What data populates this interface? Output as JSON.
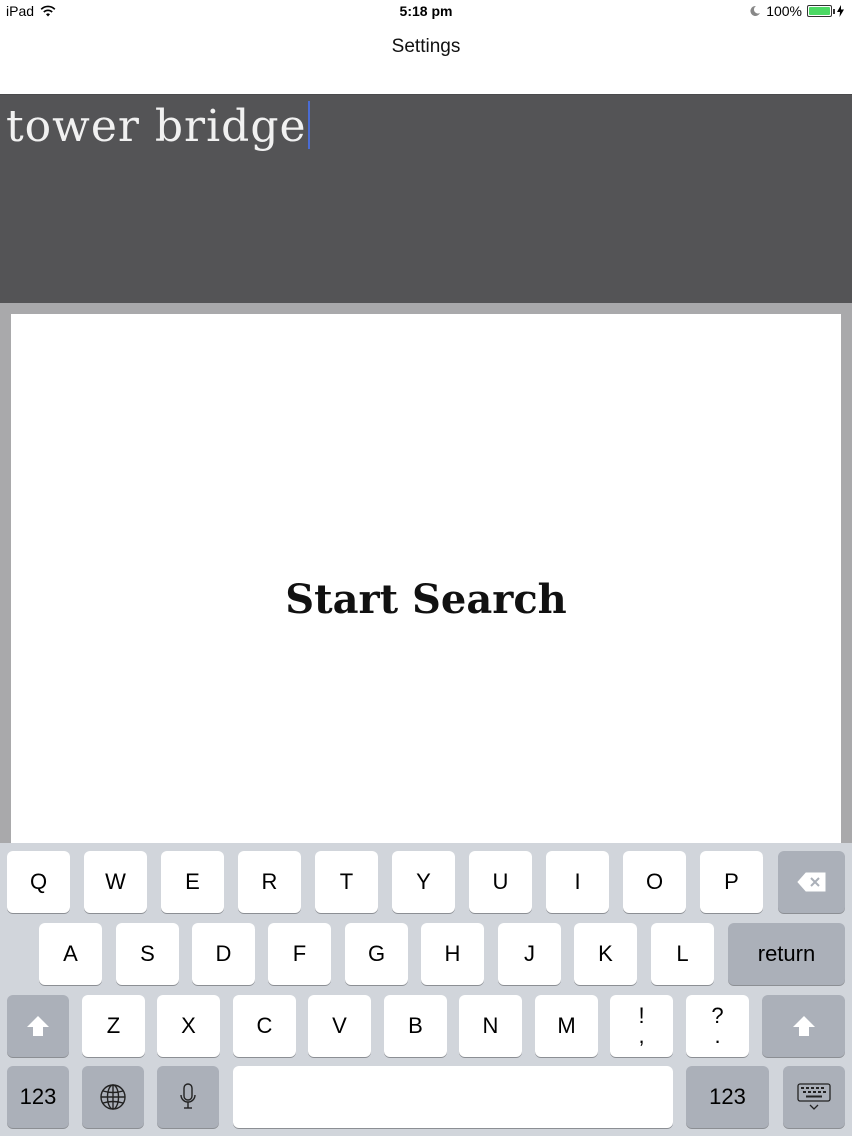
{
  "status_bar": {
    "device": "iPad",
    "time": "5:18 pm",
    "battery": "100%"
  },
  "nav": {
    "title": "Settings"
  },
  "search": {
    "value": "tower bridge"
  },
  "main": {
    "start_search_label": "Start Search"
  },
  "keyboard": {
    "row1": [
      "Q",
      "W",
      "E",
      "R",
      "T",
      "Y",
      "U",
      "I",
      "O",
      "P"
    ],
    "row2": [
      "A",
      "S",
      "D",
      "F",
      "G",
      "H",
      "J",
      "K",
      "L"
    ],
    "row3": [
      "Z",
      "X",
      "C",
      "V",
      "B",
      "N",
      "M"
    ],
    "return_label": "return",
    "punct1": [
      "!",
      ","
    ],
    "punct2": [
      "?",
      "."
    ],
    "numbers_label": "123",
    "icons": {
      "delete": "delete-icon",
      "shift": "shift-icon",
      "globe": "globe-icon",
      "mic": "microphone-icon",
      "hide": "keyboard-hide-icon"
    }
  },
  "colors": {
    "search_background": "#545456",
    "frame": "#a9a9ab",
    "keyboard_background": "#d1d5db",
    "battery_green": "#4cd964",
    "caret": "#4a6cd4"
  }
}
